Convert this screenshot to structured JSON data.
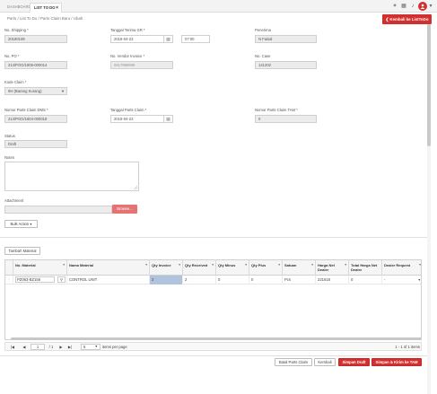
{
  "tabs": [
    {
      "label": "DASHBOARD",
      "active": false
    },
    {
      "label": "LIST TO DO",
      "active": true
    }
  ],
  "tab_close": "×",
  "top_icons": [
    "✶",
    "▦",
    "♪",
    "▾"
  ],
  "breadcrumb": "Parts  /  List To Do  /  Parts Claim Baru  /  Ubah",
  "back_button": "❮  Kembali ke ListToDo",
  "form": {
    "no_shipping": {
      "label": "No. Shipping *",
      "value": "20180109"
    },
    "tanggal_terima": {
      "label": "Tanggal Terima GR *",
      "value": "2018-04-23",
      "time": "07:00"
    },
    "penerima": {
      "label": "Penerima",
      "value": "N Faisal"
    },
    "no_po": {
      "label": "No. PO *",
      "value": "214/POG/1805-000014"
    },
    "no_vendor_invoice": {
      "label": "No. Vendor Invoice *",
      "placeholder": "0617999999"
    },
    "no_case": {
      "label": "No. Case",
      "value": "121202"
    },
    "kode_claim": {
      "label": "Kode Claim *",
      "value": "9H (Barang Kurang)"
    },
    "nomor_parts_claim_dms": {
      "label": "Nomor Parts Claim DMS *",
      "value": "214/POG/1804-000018"
    },
    "tanggal_parts_claim": {
      "label": "Tanggal Parts Claim *",
      "value": "2018-04-23"
    },
    "nomor_parts_claim_tam": {
      "label": "Nomor Parts Claim TAM *",
      "value": "0"
    },
    "status": {
      "label": "Status",
      "value": "Draft"
    },
    "notes": {
      "label": "Notes"
    },
    "attachment": {
      "label": "Attachment",
      "browse": "Browse..."
    }
  },
  "bulk_action": "Bulk Action",
  "tambah_material": "Tambah Material",
  "grid": {
    "columns": [
      "No. Material",
      "Nama Material",
      "Qty Invoice",
      "Qty Received",
      "Qty Minus",
      "Qty Plus",
      "Satuan",
      "Harga Net Dealer",
      "Total Harga Net Dealer",
      "Dealer Request"
    ],
    "rows": [
      {
        "no_material": "PZ063-BZ156",
        "nama_material": "CONTROL UNIT",
        "qty_invoice": "2",
        "qty_received": "2",
        "qty_minus": "0",
        "qty_plus": "0",
        "satuan": "Pcs",
        "harga_net": "221618",
        "total_harga": "0",
        "dealer_request": "-"
      }
    ]
  },
  "pager": {
    "page": "1",
    "of_pages": "/ 1",
    "page_size": "5",
    "items_per_page": "items per page",
    "summary": "1 - 1 of 1 items"
  },
  "footer_buttons": {
    "batal": "Batal Parts Claim",
    "kembali": "Kembali",
    "simpan_draft": "Simpan Draft",
    "simpan_kirim": "Simpan & Kirim ke TAM"
  },
  "colors": {
    "accent": "#d32f2f",
    "accent_light": "#e57373",
    "selected_cell": "#b0c4de"
  }
}
